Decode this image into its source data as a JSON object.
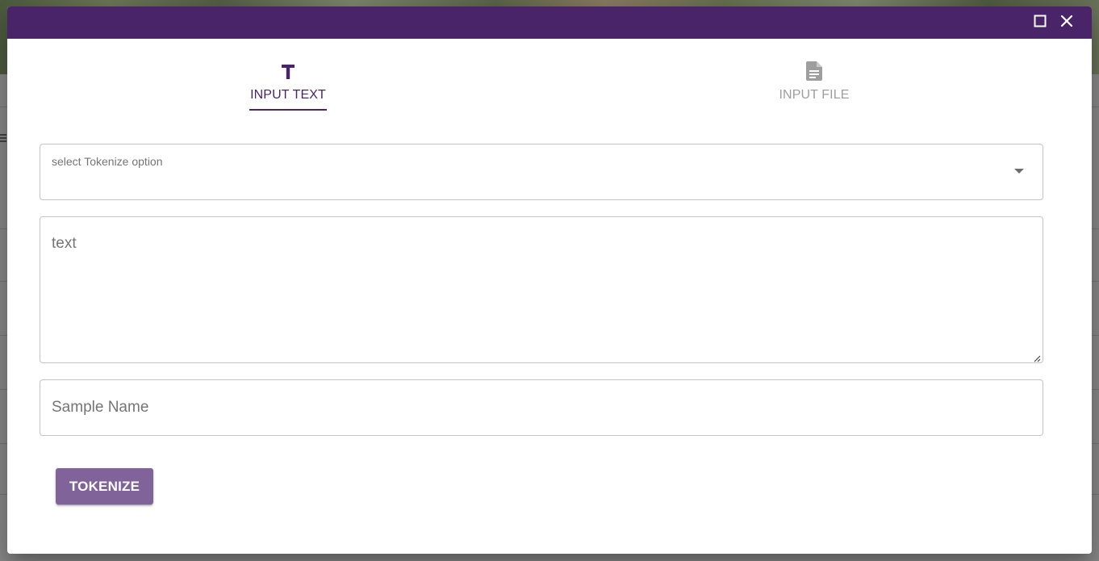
{
  "colors": {
    "titlebar": "#4a2468",
    "accent": "#4a2468",
    "tab_inactive": "#9e9e9e",
    "button_bg": "#7f6399",
    "button_text": "#ffffff",
    "field_border": "#c4c4c4"
  },
  "titlebar": {
    "icons": [
      "maximize-icon",
      "close-icon"
    ]
  },
  "tabs": [
    {
      "label": "INPUT TEXT",
      "icon": "text-format-icon",
      "active": true
    },
    {
      "label": "INPUT FILE",
      "icon": "file-document-icon",
      "active": false
    }
  ],
  "form": {
    "tokenize_select": {
      "label": "select Tokenize option",
      "value": ""
    },
    "text_area": {
      "placeholder": "text",
      "value": ""
    },
    "sample_name": {
      "placeholder": "Sample Name",
      "value": ""
    },
    "submit_label": "TOKENIZE"
  }
}
